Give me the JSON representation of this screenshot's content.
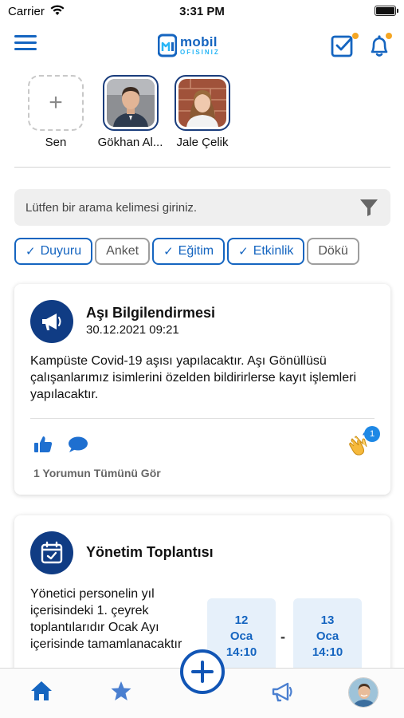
{
  "status_bar": {
    "carrier": "Carrier",
    "time": "3:31 PM"
  },
  "header": {
    "logo_line1": "mobil",
    "logo_line2": "OFISINIZ",
    "accent_color": "#1565c0",
    "badge_color": "#f5a623"
  },
  "stories": [
    {
      "name": "Sen",
      "kind": "add"
    },
    {
      "name": "Gökhan Al...",
      "kind": "photo"
    },
    {
      "name": "Jale Çelik",
      "kind": "photo"
    }
  ],
  "search": {
    "placeholder": "Lütfen bir arama kelimesi giriniz."
  },
  "filters": [
    {
      "label": "Duyuru",
      "selected": true
    },
    {
      "label": "Anket",
      "selected": false
    },
    {
      "label": "Eğitim",
      "selected": true
    },
    {
      "label": "Etkinlik",
      "selected": true
    },
    {
      "label": "Dökü",
      "selected": false
    }
  ],
  "posts": [
    {
      "title": "Aşı Bilgilendirmesi",
      "date": "30.12.2021 09:21",
      "body": "Kampüste Covid-19 aşısı yapılacaktır. Aşı Gönüllüsü çalışanlarımız isimlerini özelden bildirirlerse kayıt işlemleri yapılacaktır.",
      "reaction_count": "1",
      "comments_link": "1 Yorumun Tümünü Gör"
    },
    {
      "title": "Yönetim Toplantısı",
      "body": "Yönetici personelin yıl içerisindeki 1. çeyrek toplantılarıdır Ocak Ayı içerisinde tamamlanacaktır",
      "start": {
        "day": "12",
        "month": "Oca",
        "time": "14:10"
      },
      "end": {
        "day": "13",
        "month": "Oca",
        "time": "14:10"
      },
      "range_separator": "-"
    }
  ]
}
